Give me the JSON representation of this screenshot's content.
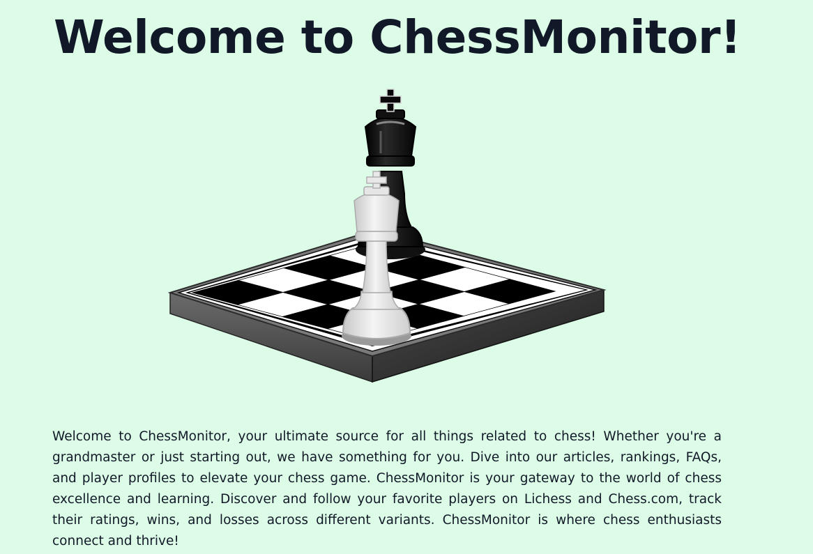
{
  "page": {
    "title": "Welcome to ChessMonitor!",
    "intro": "Welcome to ChessMonitor, your ultimate source for all things related to chess! Whether you're a grandmaster or just starting out, we have something for you. Dive into our articles, rankings, FAQs, and player profiles to elevate your chess game. ChessMonitor is your gateway to the world of chess excellence and learning. Discover and follow your favorite players on Lichess and Chess.com, track their ratings, wins, and losses across different variants. ChessMonitor is where chess enthusiasts connect and thrive!"
  },
  "hero": {
    "image": "chessboard-with-black-and-white-kings"
  },
  "colors": {
    "background": "#dcfce7",
    "text": "#111827"
  }
}
